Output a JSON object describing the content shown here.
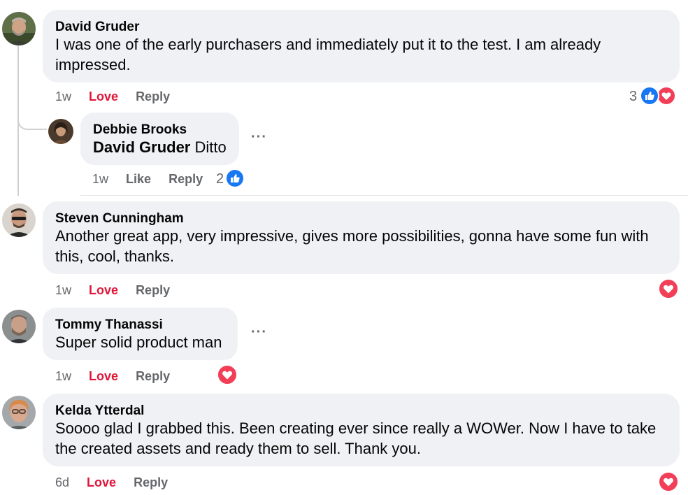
{
  "comments": [
    {
      "author": "David Gruder",
      "text": "I was one of the early purchasers and immediately put it to the test. I am already impressed.",
      "time": "1w",
      "action": "Love",
      "reply": "Reply",
      "reaction_count": "3",
      "reactions": [
        "like-icon",
        "love-icon"
      ]
    },
    {
      "author": "Debbie Brooks",
      "mention": "David Gruder",
      "text": "Ditto",
      "time": "1w",
      "action": "Like",
      "reply": "Reply",
      "reaction_count": "2",
      "reactions": [
        "like-icon"
      ],
      "more": "···"
    },
    {
      "author": "Steven Cunningham",
      "text": "Another great app, very impressive, gives more possibilities, gonna have some fun with this, cool, thanks.",
      "time": "1w",
      "action": "Love",
      "reply": "Reply",
      "reactions": [
        "love-icon"
      ]
    },
    {
      "author": "Tommy Thanassi",
      "text": "Super solid product man",
      "time": "1w",
      "action": "Love",
      "reply": "Reply",
      "reactions": [
        "love-icon"
      ],
      "more": "···"
    },
    {
      "author": "Kelda Ytterdal",
      "text": "Soooo glad I grabbed this. Been creating ever since really a WOWer. Now I have to take the created assets and ready them to sell. Thank you.",
      "time": "6d",
      "action": "Love",
      "reply": "Reply",
      "reactions": [
        "love-icon"
      ]
    }
  ],
  "colors": {
    "bubble": "#eff1f4",
    "love": "#e0173b",
    "like_blue": "#1877f2",
    "love_red": "#f33e58",
    "muted": "#65676b"
  }
}
